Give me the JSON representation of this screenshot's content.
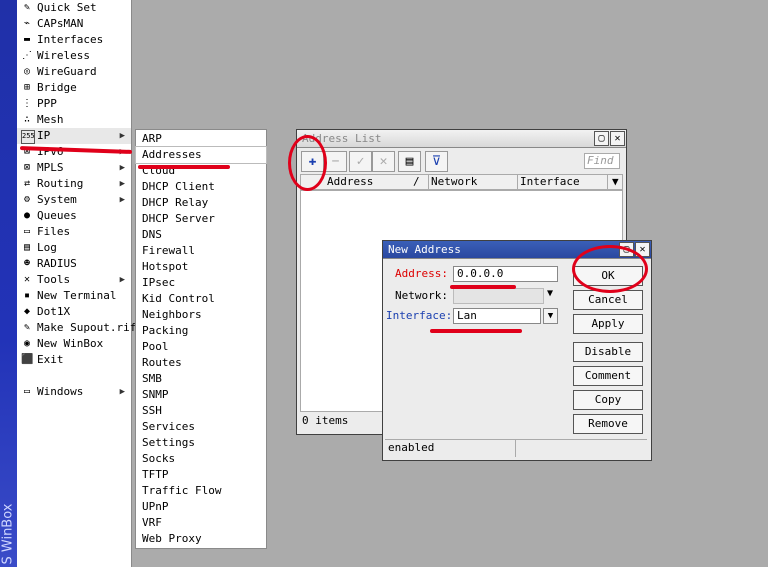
{
  "app": {
    "sidebar_title": "S WinBox"
  },
  "menu": {
    "items": [
      {
        "label": "Quick Set",
        "icon": "wand-icon",
        "glyph": "✎"
      },
      {
        "label": "CAPsMAN",
        "icon": "antenna-icon",
        "glyph": "⌁"
      },
      {
        "label": "Interfaces",
        "icon": "interfaces-icon",
        "glyph": "▬"
      },
      {
        "label": "Wireless",
        "icon": "wireless-icon",
        "glyph": "⋰"
      },
      {
        "label": "WireGuard",
        "icon": "wireguard-icon",
        "glyph": "◎"
      },
      {
        "label": "Bridge",
        "icon": "bridge-icon",
        "glyph": "⊞"
      },
      {
        "label": "PPP",
        "icon": "ppp-icon",
        "glyph": "⋮"
      },
      {
        "label": "Mesh",
        "icon": "mesh-icon",
        "glyph": "∴"
      },
      {
        "label": "IP",
        "icon": "ip-icon",
        "glyph": "255",
        "submenu": true
      },
      {
        "label": "IPv6",
        "icon": "ipv6-icon",
        "glyph": "⊠",
        "submenu": true
      },
      {
        "label": "MPLS",
        "icon": "mpls-icon",
        "glyph": "⊠",
        "submenu": true
      },
      {
        "label": "Routing",
        "icon": "routing-icon",
        "glyph": "⇄",
        "submenu": true
      },
      {
        "label": "System",
        "icon": "system-icon",
        "glyph": "⚙",
        "submenu": true
      },
      {
        "label": "Queues",
        "icon": "queues-icon",
        "glyph": "●"
      },
      {
        "label": "Files",
        "icon": "files-icon",
        "glyph": "▭"
      },
      {
        "label": "Log",
        "icon": "log-icon",
        "glyph": "▤"
      },
      {
        "label": "RADIUS",
        "icon": "radius-icon",
        "glyph": "☻"
      },
      {
        "label": "Tools",
        "icon": "tools-icon",
        "glyph": "✕",
        "submenu": true
      },
      {
        "label": "New Terminal",
        "icon": "terminal-icon",
        "glyph": "▪"
      },
      {
        "label": "Dot1X",
        "icon": "dot1x-icon",
        "glyph": "◆"
      },
      {
        "label": "Make Supout.rif",
        "icon": "supout-icon",
        "glyph": "✎"
      },
      {
        "label": "New WinBox",
        "icon": "winbox-icon",
        "glyph": "◉"
      },
      {
        "label": "Exit",
        "icon": "exit-icon",
        "glyph": "⬛"
      },
      {
        "label": "",
        "separator": true
      },
      {
        "label": "Windows",
        "icon": "windows-icon",
        "glyph": "▭",
        "submenu": true
      }
    ]
  },
  "ip_submenu": {
    "items": [
      "ARP",
      "Addresses",
      "Cloud",
      "DHCP Client",
      "DHCP Relay",
      "DHCP Server",
      "DNS",
      "Firewall",
      "Hotspot",
      "IPsec",
      "Kid Control",
      "Neighbors",
      "Packing",
      "Pool",
      "Routes",
      "SMB",
      "SNMP",
      "SSH",
      "Services",
      "Settings",
      "Socks",
      "TFTP",
      "Traffic Flow",
      "UPnP",
      "VRF",
      "Web Proxy"
    ],
    "selected": "Addresses"
  },
  "address_list": {
    "title": "Address List",
    "find_placeholder": "Find",
    "columns": [
      "Address",
      "Network",
      "Interface"
    ],
    "status": "0 items"
  },
  "new_address": {
    "title": "New Address",
    "address_label": "Address:",
    "address_value": "0.0.0.0",
    "network_label": "Network:",
    "network_value": "",
    "interface_label": "Interface:",
    "interface_value": "Lan",
    "buttons": {
      "ok": "OK",
      "cancel": "Cancel",
      "apply": "Apply",
      "disable": "Disable",
      "comment": "Comment",
      "copy": "Copy",
      "remove": "Remove"
    },
    "status": "enabled"
  },
  "colors": {
    "annotation": "#e0001a",
    "sidebar": "#2233b8"
  }
}
